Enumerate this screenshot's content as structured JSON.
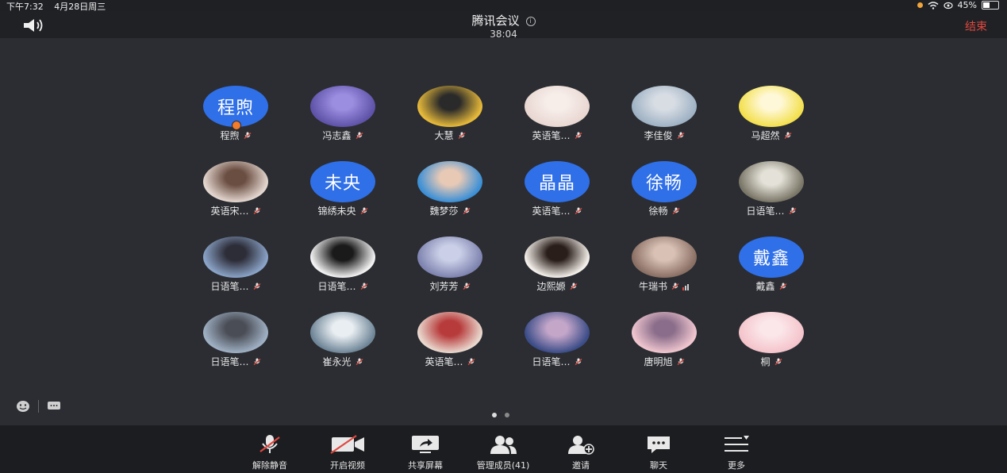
{
  "status_bar": {
    "time": "下午7:32",
    "date": "4月28日周三",
    "battery": "45%",
    "battery_level": 0.45
  },
  "header": {
    "title": "腾讯会议",
    "timer": "38:04",
    "end_label": "结束"
  },
  "participants": [
    {
      "name": "程煦",
      "avatar_text": "程煦",
      "avatar_color": "#2f6fe8",
      "host": true
    },
    {
      "name": "冯志鑫",
      "avatar_img": "purple-cartoon-avatar"
    },
    {
      "name": "大慧",
      "avatar_img": "yellow-girl-glasses-avatar"
    },
    {
      "name": "英语笔…",
      "avatar_img": "pink-bunny-avatar"
    },
    {
      "name": "李佳俊",
      "avatar_img": "anime-boy-avatar"
    },
    {
      "name": "马超然",
      "avatar_img": "yellow-cat-avatar"
    },
    {
      "name": "英语宋…",
      "avatar_img": "girl-portrait-avatar"
    },
    {
      "name": "锦绣未央",
      "avatar_text": "未央",
      "avatar_color": "#2f6fe8"
    },
    {
      "name": "魏梦莎",
      "avatar_img": "girl-blue-avatar"
    },
    {
      "name": "英语笔…",
      "avatar_text": "晶晶",
      "avatar_color": "#2f6fe8"
    },
    {
      "name": "徐畅",
      "avatar_text": "徐畅",
      "avatar_color": "#2f6fe8"
    },
    {
      "name": "日语笔…",
      "avatar_img": "white-dog-avatar"
    },
    {
      "name": "日语笔…",
      "avatar_img": "boy-portrait-avatar"
    },
    {
      "name": "日语笔…",
      "avatar_img": "sketch-face-avatar"
    },
    {
      "name": "刘芳芳",
      "avatar_img": "purple-sky-avatar"
    },
    {
      "name": "边熙嫄",
      "avatar_img": "girl-long-hair-avatar"
    },
    {
      "name": "牛瑞书",
      "avatar_img": "girl-camera-avatar",
      "signal": true
    },
    {
      "name": "戴鑫",
      "avatar_text": "戴鑫",
      "avatar_color": "#2f6fe8"
    },
    {
      "name": "日语笔…",
      "avatar_img": "astronaut-avatar"
    },
    {
      "name": "崔永光",
      "avatar_img": "snow-mountain-avatar"
    },
    {
      "name": "英语笔…",
      "avatar_img": "anime-girl-avatar"
    },
    {
      "name": "日语笔…",
      "avatar_img": "city-sunset-avatar"
    },
    {
      "name": "唐明旭",
      "avatar_img": "pink-anime-girl-avatar"
    },
    {
      "name": "桐",
      "avatar_img": "pink-hair-girl-avatar"
    }
  ],
  "pager": {
    "pages": 2,
    "current": 1
  },
  "toolbar": {
    "unmute": "解除静音",
    "video": "开启视频",
    "share": "共享屏幕",
    "members": "管理成员(41)",
    "invite": "邀请",
    "chat": "聊天",
    "more": "更多"
  }
}
